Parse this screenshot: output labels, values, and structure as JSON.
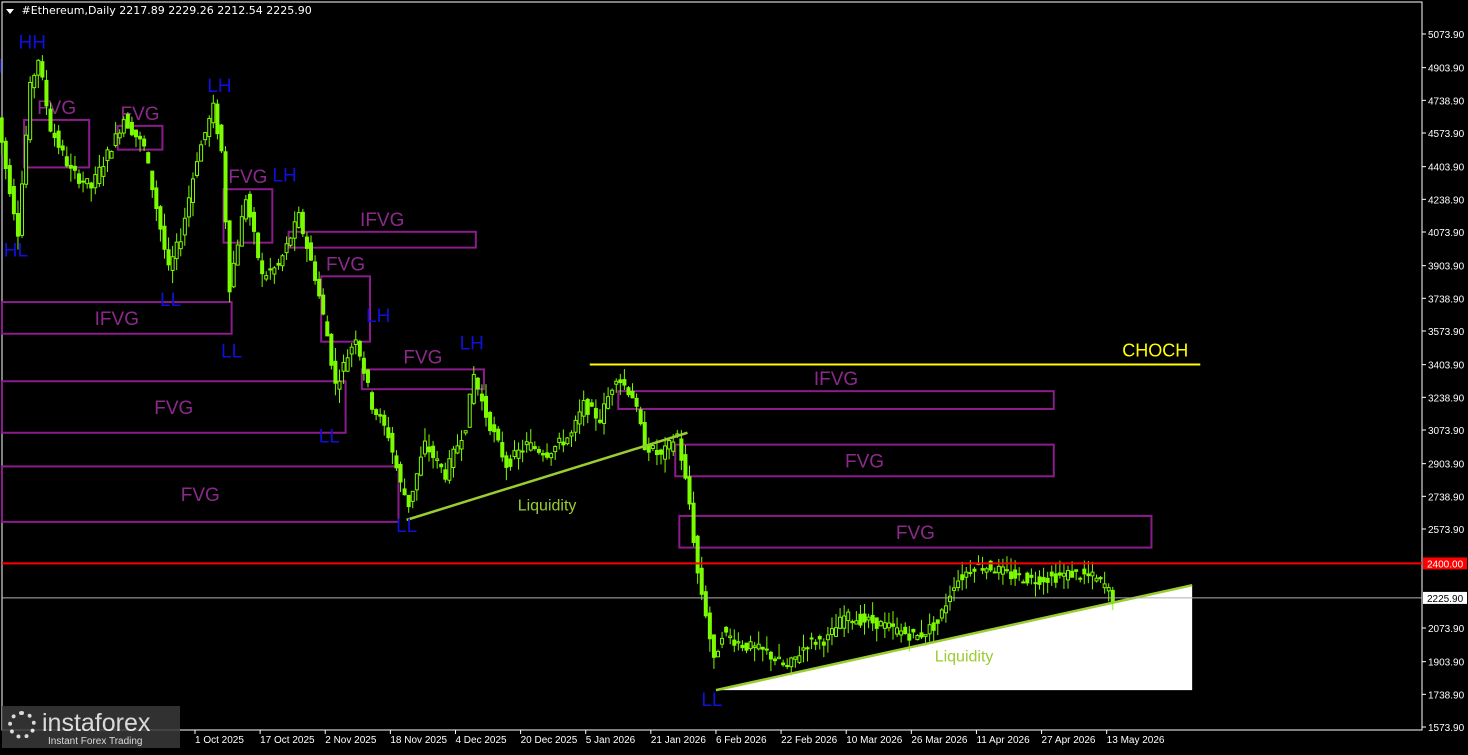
{
  "header": {
    "symbol": "#Ethereum,Daily",
    "ohlc": "2217.89 2229.26 2212.54 2225.90"
  },
  "watermark": {
    "brand": "instaforex",
    "tagline": "Instant Forex Trading",
    "icon": "gear-icon"
  },
  "colors": {
    "background": "#000000",
    "candle": "#7CFC00",
    "zone": "#8B1C8B",
    "zone_label": "#8B2A8B",
    "structure_label": "#1010DD",
    "choch": "#FFFF00",
    "level_line": "#FF0000",
    "trendline": "#9ACD32",
    "axis": "#FFFFFF"
  },
  "chart_data": {
    "type": "candlestick",
    "title": "#Ethereum,Daily",
    "ylim": [
      1550,
      5200
    ],
    "y_ticks": [
      "5073.90",
      "4903.90",
      "4738.90",
      "4573.90",
      "4403.90",
      "4238.90",
      "4073.90",
      "3903.90",
      "3738.90",
      "3573.90",
      "3403.90",
      "3238.90",
      "3073.90",
      "2903.90",
      "2738.90",
      "2573.90",
      "2400.00",
      "2225.90",
      "2073.90",
      "1903.90",
      "1738.90",
      "1573.90"
    ],
    "x_ticks": [
      "1 Oct 2025",
      "17 Oct 2025",
      "2 Nov 2025",
      "18 Nov 2025",
      "4 Dec 2025",
      "20 Dec 2025",
      "5 Jan 2026",
      "21 Jan 2026",
      "6 Feb 2026",
      "22 Feb 2026",
      "10 Mar 2026",
      "26 Mar 2026",
      "11 Apr 2026",
      "27 Apr 2026",
      "13 May 2026"
    ],
    "current_price": 2225.9,
    "current_price_label": "2225.90",
    "level": {
      "value": 2400.0,
      "label": "2400.00"
    },
    "choch": {
      "label": "CHOCH",
      "value": 3405,
      "from": "2026-01-06",
      "to": "2026-06-05"
    },
    "price_path": [
      [
        "2025-08-13",
        4780
      ],
      [
        "2025-08-16",
        4400
      ],
      [
        "2025-08-19",
        4080
      ],
      [
        "2025-08-22",
        4800
      ],
      [
        "2025-08-24",
        4950
      ],
      [
        "2025-08-27",
        4600
      ],
      [
        "2025-09-01",
        4380
      ],
      [
        "2025-09-06",
        4300
      ],
      [
        "2025-09-12",
        4550
      ],
      [
        "2025-09-14",
        4650
      ],
      [
        "2025-09-19",
        4500
      ],
      [
        "2025-09-22",
        4200
      ],
      [
        "2025-09-25",
        3880
      ],
      [
        "2025-09-28",
        4050
      ],
      [
        "2025-10-02",
        4450
      ],
      [
        "2025-10-06",
        4700
      ],
      [
        "2025-10-08",
        4480
      ],
      [
        "2025-10-10",
        3800
      ],
      [
        "2025-10-14",
        4250
      ],
      [
        "2025-10-18",
        3850
      ],
      [
        "2025-10-22",
        3900
      ],
      [
        "2025-10-27",
        4150
      ],
      [
        "2025-10-31",
        3850
      ],
      [
        "2025-11-03",
        3550
      ],
      [
        "2025-11-05",
        3300
      ],
      [
        "2025-11-10",
        3550
      ],
      [
        "2025-11-14",
        3200
      ],
      [
        "2025-11-18",
        3050
      ],
      [
        "2025-11-21",
        2800
      ],
      [
        "2025-11-23",
        2700
      ],
      [
        "2025-11-27",
        3000
      ],
      [
        "2025-12-02",
        2850
      ],
      [
        "2025-12-07",
        3100
      ],
      [
        "2025-12-09",
        3350
      ],
      [
        "2025-12-12",
        3150
      ],
      [
        "2025-12-17",
        2900
      ],
      [
        "2025-12-22",
        3000
      ],
      [
        "2025-12-27",
        2960
      ],
      [
        "2026-01-02",
        3050
      ],
      [
        "2026-01-05",
        3200
      ],
      [
        "2026-01-09",
        3130
      ],
      [
        "2026-01-13",
        3350
      ],
      [
        "2026-01-17",
        3250
      ],
      [
        "2026-01-20",
        3000
      ],
      [
        "2026-01-24",
        2940
      ],
      [
        "2026-01-28",
        3050
      ],
      [
        "2026-01-31",
        2700
      ],
      [
        "2026-02-02",
        2350
      ],
      [
        "2026-02-04",
        2150
      ],
      [
        "2026-02-06",
        1900
      ],
      [
        "2026-02-08",
        2050
      ],
      [
        "2026-02-13",
        1990
      ],
      [
        "2026-02-19",
        1950
      ],
      [
        "2026-02-24",
        1870
      ],
      [
        "2026-03-01",
        2000
      ],
      [
        "2026-03-06",
        2020
      ],
      [
        "2026-03-10",
        2130
      ],
      [
        "2026-03-13",
        2120
      ],
      [
        "2026-03-18",
        2100
      ],
      [
        "2026-03-23",
        2060
      ],
      [
        "2026-03-28",
        2030
      ],
      [
        "2026-04-02",
        2100
      ],
      [
        "2026-04-06",
        2300
      ],
      [
        "2026-04-11",
        2390
      ],
      [
        "2026-04-15",
        2380
      ],
      [
        "2026-04-20",
        2340
      ],
      [
        "2026-04-25",
        2320
      ],
      [
        "2026-04-30",
        2330
      ],
      [
        "2026-05-05",
        2350
      ],
      [
        "2026-05-10",
        2330
      ],
      [
        "2026-05-13",
        2290
      ],
      [
        "2026-05-15",
        2226
      ]
    ],
    "zones": [
      {
        "label": "FVG",
        "label_side": "above",
        "from": "2025-08-20",
        "to": "2025-09-05",
        "low": 4400,
        "high": 4640
      },
      {
        "label": "FVG",
        "label_side": "above",
        "from": "2025-09-12",
        "to": "2025-09-23",
        "low": 4490,
        "high": 4610
      },
      {
        "label": "FVG",
        "label_side": "above",
        "from": "2025-10-08",
        "to": "2025-10-20",
        "low": 4020,
        "high": 4290
      },
      {
        "label": "IFVG",
        "label_side": "above",
        "from": "2025-10-24",
        "to": "2025-12-09",
        "low": 3995,
        "high": 4075
      },
      {
        "label": "IFVG",
        "label_side": "inside",
        "from": "2025-08-12",
        "to": "2025-10-10",
        "low": 3560,
        "high": 3720
      },
      {
        "label": "FVG",
        "label_side": "above",
        "from": "2025-11-01",
        "to": "2025-11-13",
        "low": 3520,
        "high": 3850
      },
      {
        "label": "FVG",
        "label_side": "above",
        "from": "2025-11-11",
        "to": "2025-12-11",
        "low": 3280,
        "high": 3380
      },
      {
        "label": "FVG",
        "label_side": "inside",
        "from": "2025-08-12",
        "to": "2025-11-07",
        "low": 3060,
        "high": 3320
      },
      {
        "label": "FVG",
        "label_side": "inside",
        "from": "2025-08-12",
        "to": "2025-11-20",
        "low": 2610,
        "high": 2890
      },
      {
        "label": "IFVG",
        "label_side": "above",
        "from": "2026-01-13",
        "to": "2026-04-30",
        "low": 3180,
        "high": 3270
      },
      {
        "label": "FVG",
        "label_side": "inside",
        "from": "2026-01-27",
        "to": "2026-04-30",
        "low": 2840,
        "high": 3000
      },
      {
        "label": "FVG",
        "label_side": "inside",
        "from": "2026-01-28",
        "to": "2026-05-24",
        "low": 2480,
        "high": 2640
      }
    ],
    "structure_labels": [
      {
        "label": "H",
        "date": "2025-08-13",
        "value": 4880
      },
      {
        "label": "HH",
        "date": "2025-08-22",
        "value": 5000
      },
      {
        "label": "HL",
        "date": "2025-08-18",
        "value": 3950
      },
      {
        "label": "LH",
        "date": "2025-10-07",
        "value": 4780
      },
      {
        "label": "LL",
        "date": "2025-09-25",
        "value": 3700
      },
      {
        "label": "LH",
        "date": "2025-10-23",
        "value": 4330
      },
      {
        "label": "LL",
        "date": "2025-10-10",
        "value": 3440
      },
      {
        "label": "LH",
        "date": "2025-11-15",
        "value": 3620
      },
      {
        "label": "LL",
        "date": "2025-11-03",
        "value": 3010
      },
      {
        "label": "LH",
        "date": "2025-12-08",
        "value": 3480
      },
      {
        "label": "LL",
        "date": "2025-11-22",
        "value": 2560
      },
      {
        "label": "LL",
        "date": "2026-02-05",
        "value": 1680
      }
    ],
    "trendlines": [
      {
        "label": "Liquidity",
        "from": [
          "2025-11-22",
          2620
        ],
        "to": [
          "2026-01-30",
          3060
        ]
      },
      {
        "label": "Liquidity",
        "from": [
          "2026-02-06",
          1760
        ],
        "to": [
          "2026-06-03",
          2290
        ]
      }
    ]
  }
}
